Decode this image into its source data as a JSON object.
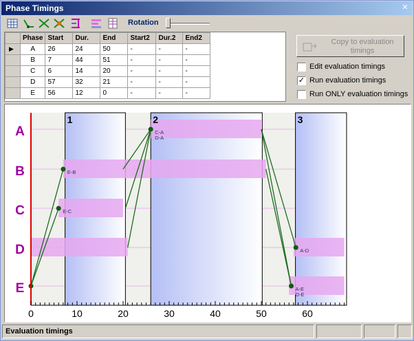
{
  "window": {
    "title": "Phase Timings"
  },
  "toolbar": {
    "rotation_label": "Rotation",
    "rotation_value": 0,
    "icons": [
      "grid-icon",
      "line-green-icon",
      "cross-green-icon",
      "cross-orange-icon",
      "bracket-icon",
      "bars-icon",
      "table-icon"
    ]
  },
  "table": {
    "headers": [
      "Phase",
      "Start",
      "Dur.",
      "End",
      "Start2",
      "Dur.2",
      "End2"
    ],
    "rows": [
      [
        "A",
        "26",
        "24",
        "50",
        "-",
        "-",
        "-"
      ],
      [
        "B",
        "7",
        "44",
        "51",
        "-",
        "-",
        "-"
      ],
      [
        "C",
        "6",
        "14",
        "20",
        "-",
        "-",
        "-"
      ],
      [
        "D",
        "57",
        "32",
        "21",
        "-",
        "-",
        "-"
      ],
      [
        "E",
        "56",
        "12",
        "0",
        "-",
        "-",
        "-"
      ]
    ]
  },
  "copy_button": {
    "label": "Copy to evaluation timings"
  },
  "options": [
    {
      "label": "Edit evaluation timings",
      "checked": false
    },
    {
      "label": "Run evaluation timings",
      "checked": true
    },
    {
      "label": "Run ONLY evaluation timings",
      "checked": false
    }
  ],
  "chart_data": {
    "type": "timing-diagram",
    "rows": [
      "A",
      "B",
      "C",
      "D",
      "E"
    ],
    "x_ticks": [
      0,
      10,
      20,
      30,
      40,
      50,
      60
    ],
    "xlim": [
      0,
      68
    ],
    "stages": [
      {
        "label": "1",
        "start": 7.4,
        "end": 20.5
      },
      {
        "label": "2",
        "start": 26,
        "end": 50.2
      },
      {
        "label": "3",
        "start": 57.4,
        "end": 68.5
      }
    ],
    "bars": [
      {
        "phase": "A",
        "start": 26,
        "end": 50
      },
      {
        "phase": "B",
        "start": 7,
        "end": 51
      },
      {
        "phase": "C",
        "start": 6,
        "end": 20
      },
      {
        "phase": "D",
        "start": 0,
        "end": 21
      },
      {
        "phase": "D",
        "start": 57,
        "end": 68
      },
      {
        "phase": "E",
        "start": 56,
        "end": 68
      }
    ],
    "nodes": [
      {
        "phase": "E",
        "t": 0,
        "label": ""
      },
      {
        "phase": "B",
        "t": 7,
        "label": "E-B"
      },
      {
        "phase": "C",
        "t": 6,
        "label": "E-C"
      },
      {
        "phase": "A",
        "t": 26,
        "label": "C-A\nD-A"
      },
      {
        "phase": "D",
        "t": 57.5,
        "label": "A-D"
      },
      {
        "phase": "E",
        "t": 56.5,
        "label": "A-E\nD-E"
      }
    ],
    "links": [
      [
        "E",
        0,
        "B",
        7
      ],
      [
        "E",
        0,
        "C",
        6
      ],
      [
        "B",
        20,
        "A",
        26
      ],
      [
        "C",
        20.5,
        "A",
        26
      ],
      [
        "D",
        21,
        "A",
        26
      ],
      [
        "A",
        50,
        "D",
        57.5
      ],
      [
        "A",
        50,
        "E",
        56.5
      ],
      [
        "B",
        51,
        "E",
        56.5
      ]
    ],
    "colors": {
      "phase_label": "#a000a0",
      "bar": "#e6a8f0",
      "stage_left": "#b9c3f5",
      "link": "#1e6b1e",
      "node": "#0f5a0f",
      "axis_red": "#e00000"
    }
  },
  "status": {
    "text": "Evaluation timings"
  }
}
